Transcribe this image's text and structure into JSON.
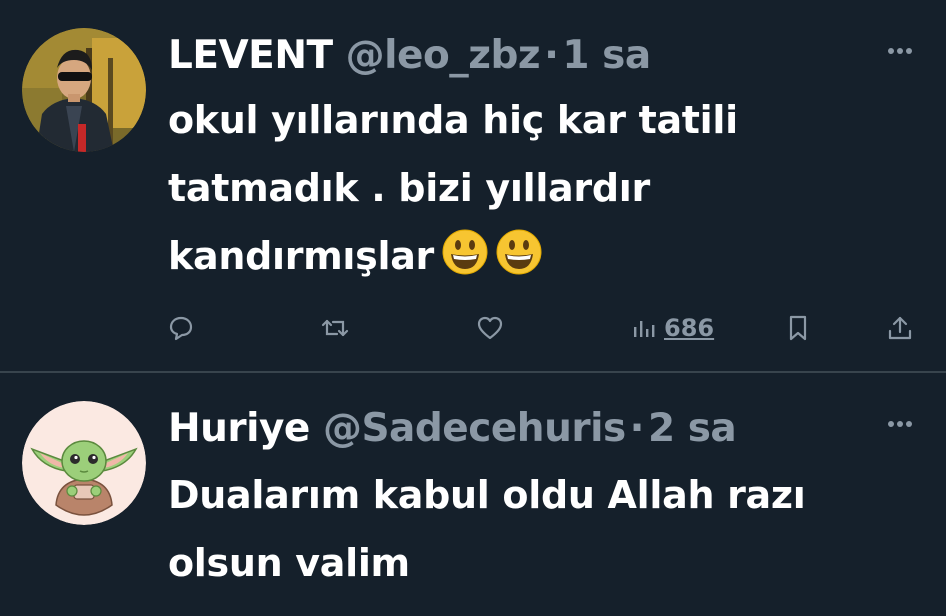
{
  "tweets": [
    {
      "name": "LEVENT",
      "handle": "@leo_zbz",
      "separator": "·",
      "time": "1 sa",
      "text": "okul yıllarında hiç kar tatili tatmadık . bizi yıllardır kandırmışlar",
      "emoji": [
        "grinning-face",
        "grinning-face"
      ],
      "views": "686"
    },
    {
      "name": "Huriye",
      "handle": "@Sadecehuris",
      "separator": "·",
      "time": "2 sa",
      "text": "Dualarım kabul oldu Allah razı olsun valim"
    }
  ],
  "icons": {
    "reply": "speech-bubble-icon",
    "retweet": "retweet-icon",
    "like": "heart-icon",
    "views": "bar-chart-icon",
    "bookmark": "bookmark-icon",
    "share": "share-upload-icon",
    "more": "three-dots-icon"
  },
  "colors": {
    "background": "#15202b",
    "text": "#ffffff",
    "secondary": "#8b98a5",
    "divider": "#38444d"
  }
}
